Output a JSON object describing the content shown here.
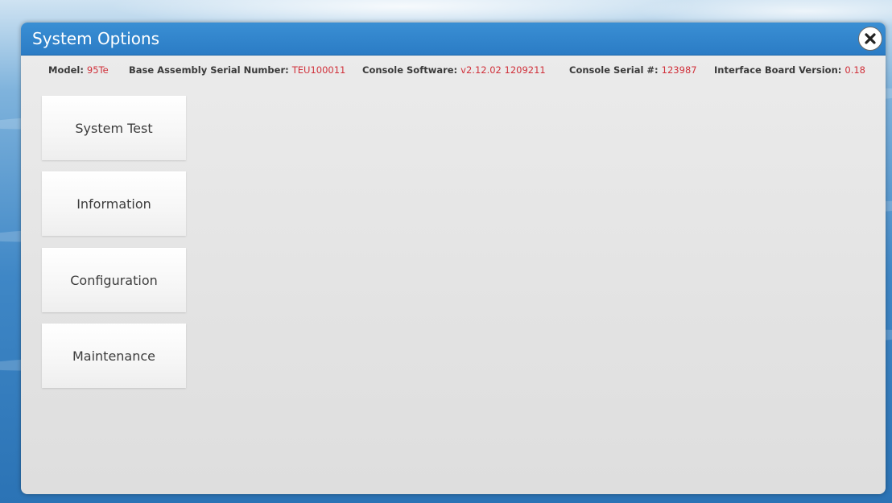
{
  "window": {
    "title": "System Options",
    "close_icon": "close-icon"
  },
  "info": {
    "model_label": "Model: ",
    "model_value": "95Te",
    "base_serial_label": "Base Assembly Serial Number: ",
    "base_serial_value": "TEU100011",
    "console_software_label": "Console Software: ",
    "console_software_value": "v2.12.02 1209211",
    "console_serial_label": "Console Serial #: ",
    "console_serial_value": "123987",
    "interface_board_label": "Interface Board Version: ",
    "interface_board_value": "0.18"
  },
  "menu": {
    "items": [
      {
        "label": "System Test"
      },
      {
        "label": "Information"
      },
      {
        "label": "Configuration"
      },
      {
        "label": "Maintenance"
      }
    ]
  },
  "colors": {
    "titlebar": "#2b7cc5",
    "value_red": "#d0303a",
    "panel_bg": "#e3e3e3"
  }
}
